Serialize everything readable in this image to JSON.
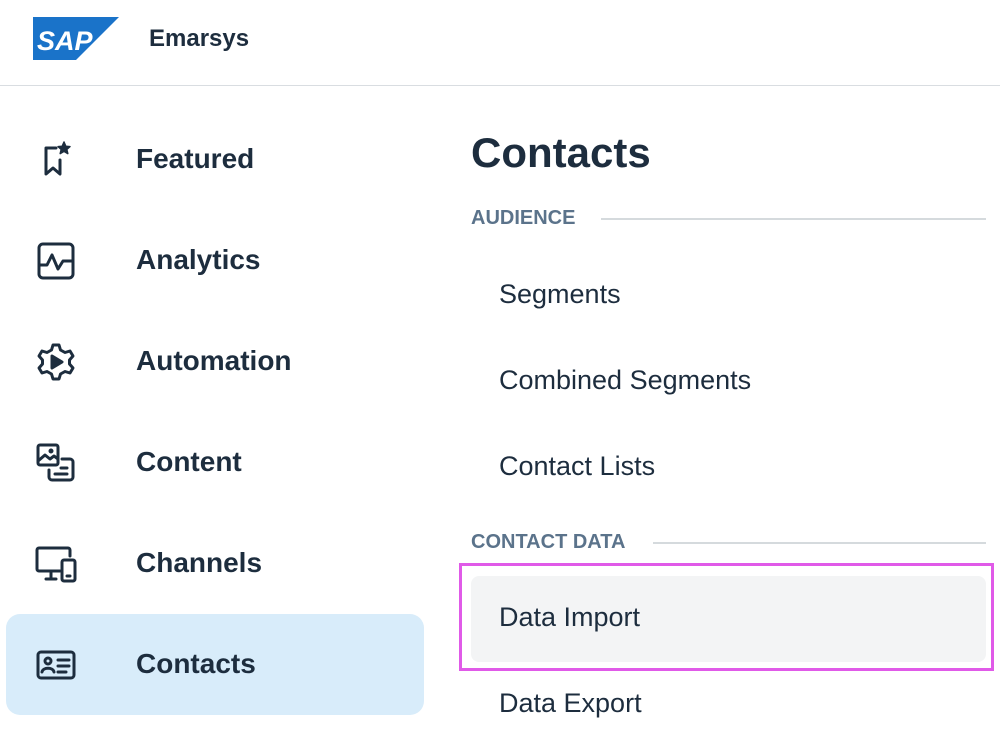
{
  "header": {
    "logo_text": "SAP",
    "product_name": "Emarsys",
    "brand_color": "#1a73c9"
  },
  "sidebar": {
    "items": [
      {
        "label": "Featured",
        "icon": "bookmark-star-icon",
        "active": false
      },
      {
        "label": "Analytics",
        "icon": "analytics-chart-icon",
        "active": false
      },
      {
        "label": "Automation",
        "icon": "gear-play-icon",
        "active": false
      },
      {
        "label": "Content",
        "icon": "image-document-icon",
        "active": false
      },
      {
        "label": "Channels",
        "icon": "monitor-mobile-icon",
        "active": false
      },
      {
        "label": "Contacts",
        "icon": "contact-card-icon",
        "active": true
      }
    ],
    "active_color": "#d8ecfa"
  },
  "content": {
    "title": "Contacts",
    "groups": [
      {
        "label": "AUDIENCE",
        "items": [
          "Segments",
          "Combined Segments",
          "Contact Lists"
        ]
      },
      {
        "label": "CONTACT DATA",
        "items": [
          "Data Import",
          "Data Export"
        ]
      }
    ],
    "hovered_item": "Data Import",
    "highlight_color": "#e05ae8"
  }
}
